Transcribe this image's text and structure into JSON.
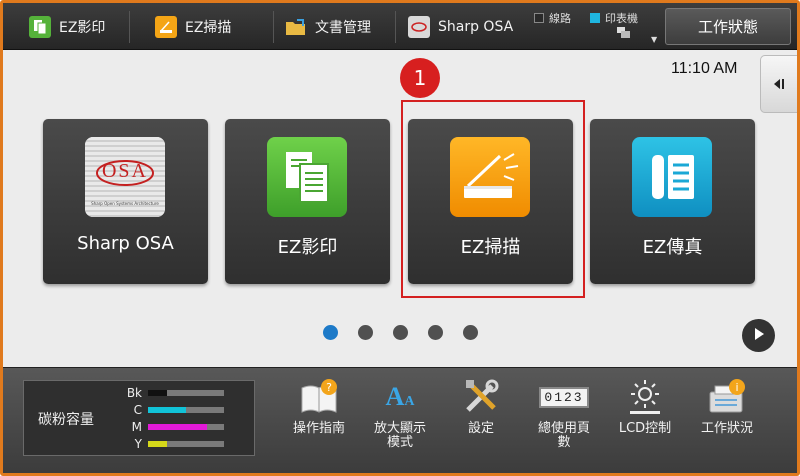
{
  "topbar": {
    "items": [
      {
        "label": "EZ影印",
        "icon": "copy-icon"
      },
      {
        "label": "EZ掃描",
        "icon": "scan-icon"
      },
      {
        "label": "文書管理",
        "icon": "folder-icon"
      },
      {
        "label": "Sharp OSA",
        "icon": "osa-icon"
      }
    ],
    "status": {
      "line": "線路",
      "printer": "印表機"
    },
    "job_status_button": "工作狀態"
  },
  "clock": "11:10 AM",
  "annotation_badge": "1",
  "tiles": [
    {
      "label": "Sharp OSA",
      "icon": "osa-logo-icon",
      "osa_text": "OSA",
      "osa_sub": "Sharp Open Systems Architecture"
    },
    {
      "label": "EZ影印",
      "icon": "copy-icon"
    },
    {
      "label": "EZ掃描",
      "icon": "scan-icon"
    },
    {
      "label": "EZ傳真",
      "icon": "fax-icon"
    }
  ],
  "pagination": {
    "pages": 5,
    "active": 0
  },
  "toner": {
    "label": "碳粉容量",
    "levels": [
      {
        "color_name": "Bk",
        "color": "#111111",
        "level": 0.25
      },
      {
        "color_name": "C",
        "color": "#11c3d8",
        "level": 0.5
      },
      {
        "color_name": "M",
        "color": "#e21ad8",
        "level": 0.78
      },
      {
        "color_name": "Y",
        "color": "#d5d81a",
        "level": 0.25
      }
    ]
  },
  "tools": [
    {
      "label": "操作指南",
      "icon": "operation-guide-icon"
    },
    {
      "label": "放大顯示\n模式",
      "icon": "enlarge-display-icon",
      "glyph_a": "A",
      "glyph_b": "A"
    },
    {
      "label": "設定",
      "icon": "settings-tools-icon"
    },
    {
      "label": "總使用頁\n數",
      "icon": "page-counter-icon",
      "counter": "0123"
    },
    {
      "label": "LCD控制",
      "icon": "brightness-icon"
    },
    {
      "label": "工作狀況",
      "icon": "job-status-icon"
    }
  ],
  "colors": {
    "accent": "#1d7ac8",
    "frame": "#e07a1d",
    "highlight": "#d42020"
  }
}
